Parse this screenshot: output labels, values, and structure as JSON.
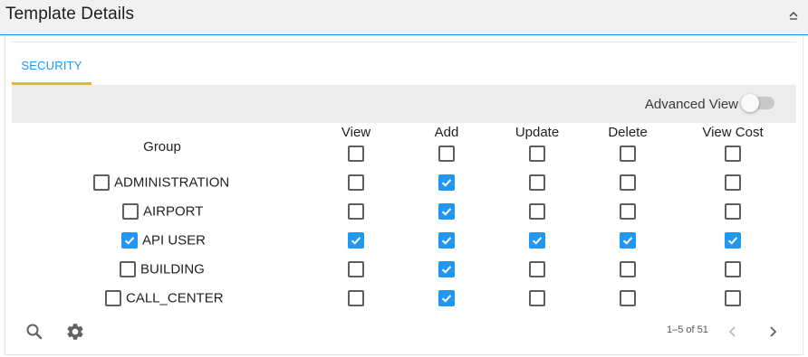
{
  "header": {
    "title": "Template Details",
    "collapse_icon": "chevron-up-icon"
  },
  "tabs": [
    {
      "label": "SECURITY",
      "active": true,
      "accent": "#f0b323",
      "color": "#2196f3"
    }
  ],
  "toolbar": {
    "advanced_view_label": "Advanced View",
    "advanced_view_on": false
  },
  "table": {
    "group_header": "Group",
    "columns": [
      "View",
      "Add",
      "Update",
      "Delete",
      "View Cost"
    ],
    "header_checks": [
      false,
      false,
      false,
      false,
      false
    ],
    "rows": [
      {
        "group": "ADMINISTRATION",
        "group_checked": false,
        "perms": [
          false,
          true,
          false,
          false,
          false
        ]
      },
      {
        "group": "AIRPORT",
        "group_checked": false,
        "perms": [
          false,
          true,
          false,
          false,
          false
        ]
      },
      {
        "group": "API USER",
        "group_checked": true,
        "perms": [
          true,
          true,
          true,
          true,
          true
        ]
      },
      {
        "group": "BUILDING",
        "group_checked": false,
        "perms": [
          false,
          true,
          false,
          false,
          false
        ]
      },
      {
        "group": "CALL_CENTER",
        "group_checked": false,
        "perms": [
          false,
          true,
          false,
          false,
          false
        ]
      }
    ]
  },
  "footer": {
    "icons": [
      "search-icon",
      "gear-icon"
    ],
    "pagination_text": "1–5 of 51",
    "prev_icon": "chevron-left-icon",
    "next_icon": "chevron-right-icon"
  },
  "colors": {
    "accent_blue": "#2196f3",
    "tab_underline": "#f0b323",
    "header_border": "#1f8fdc"
  }
}
